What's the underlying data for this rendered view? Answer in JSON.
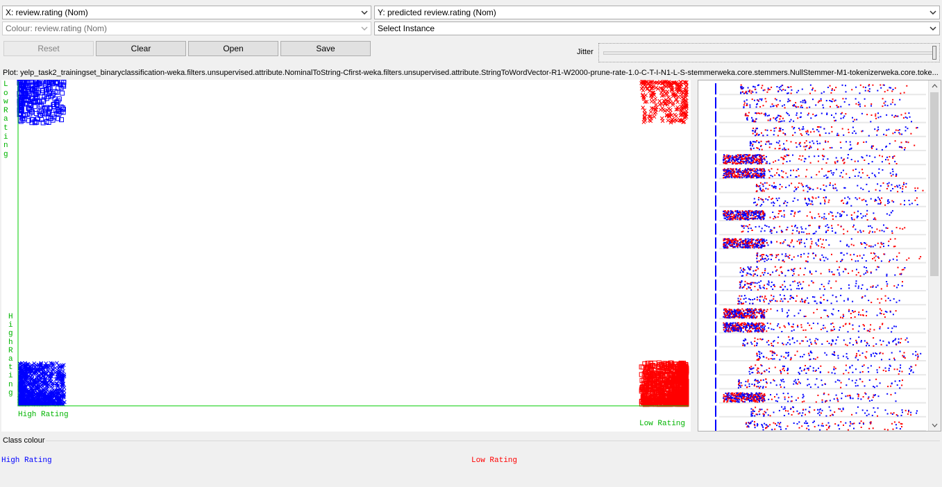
{
  "controls": {
    "x_axis": "X: review.rating (Nom)",
    "y_axis": "Y: predicted review.rating (Nom)",
    "colour": "Colour: review.rating (Nom)",
    "instance": "Select Instance",
    "reset_label": "Reset",
    "clear_label": "Clear",
    "open_label": "Open",
    "save_label": "Save",
    "jitter_label": "Jitter",
    "jitter_value": 1.0
  },
  "plot": {
    "title": "Plot: yelp_task2_trainingset_binaryclassification-weka.filters.unsupervised.attribute.NominalToString-Cfirst-weka.filters.unsupervised.attribute.StringToWordVector-R1-W2000-prune-rate-1.0-C-T-I-N1-L-S-stemmerweka.core.stemmers.NullStemmer-M1-tokenizerweka.core.toke...",
    "x_left_label": "High Rating",
    "x_right_label": "Low Rating",
    "y_top_label": "Low Rating",
    "y_bottom_label": "High Rating"
  },
  "chart_data": {
    "type": "scatter",
    "x_categories": [
      "High Rating",
      "Low Rating"
    ],
    "y_categories": [
      "High Rating",
      "Low Rating"
    ],
    "jitter": 1.0,
    "cells": [
      {
        "x": "High Rating",
        "y": "High Rating",
        "class": "High Rating",
        "marker": "x",
        "correct": true,
        "density": "very high"
      },
      {
        "x": "High Rating",
        "y": "Low Rating",
        "class": "High Rating",
        "marker": "square",
        "correct": false,
        "density": "medium"
      },
      {
        "x": "Low Rating",
        "y": "Low Rating",
        "class": "Low Rating",
        "marker": "x",
        "correct": true,
        "density": "medium"
      },
      {
        "x": "Low Rating",
        "y": "High Rating",
        "class": "Low Rating",
        "marker": "square",
        "correct": false,
        "density": "very high"
      }
    ]
  },
  "legend": {
    "title": "Class colour",
    "items": [
      {
        "label": "High Rating",
        "color": "#0000ff"
      },
      {
        "label": "Low Rating",
        "color": "#ff0000"
      }
    ]
  },
  "colors": {
    "high_rating": "#0000ff",
    "low_rating": "#ff0000",
    "axis": "#00cc00",
    "axis_label": "#00b400"
  },
  "attribute_panel": {
    "rows": 25,
    "row_dense": [
      false,
      false,
      false,
      false,
      false,
      true,
      true,
      false,
      false,
      true,
      false,
      true,
      false,
      false,
      false,
      false,
      true,
      true,
      false,
      false,
      false,
      false,
      true,
      false,
      false
    ]
  }
}
